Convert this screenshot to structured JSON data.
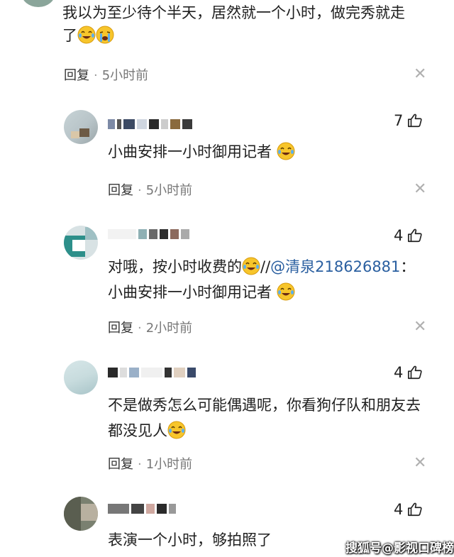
{
  "top_comment": {
    "text_line1": "我以为至少待个半天，居然就一个小时，做完秀就走",
    "text_line2": "了",
    "reply_label": "回复",
    "dot": "·",
    "time": "5小时前"
  },
  "replies": [
    {
      "likes": "7",
      "text_line1": "小曲安排一小时御用记者",
      "reply_label": "回复",
      "dot": "·",
      "time": "5小时前"
    },
    {
      "likes": "4",
      "text_prefix": "对哦，按小时收费的",
      "text_sep": "//",
      "mention": "@清泉218626881",
      "text_colon": "：",
      "text_line2": "小曲安排一小时御用记者",
      "reply_label": "回复",
      "dot": "·",
      "time": "2小时前"
    },
    {
      "likes": "4",
      "text_line1": "不是做秀怎么可能偶遇呢，你看狗仔队和朋友去",
      "text_line2": "都没见人",
      "reply_label": "回复",
      "dot": "·",
      "time": "1小时前"
    },
    {
      "likes": "4",
      "text_line1": "表演一个小时，够拍照了"
    }
  ],
  "icons": {
    "like": "thumbs-up-icon",
    "close": "close-icon",
    "emoji_laugh": "tears-of-joy-icon",
    "emoji_cry": "crying-icon"
  },
  "close_glyph": "✕",
  "watermark": "搜狐号@影视口碑榜",
  "colors": {
    "mention": "#2a5fa0",
    "meta": "#777777"
  }
}
